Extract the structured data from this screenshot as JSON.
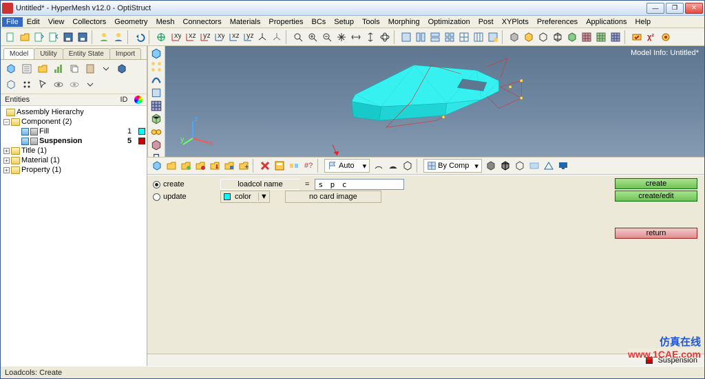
{
  "title": "Untitled* - HyperMesh v12.0 - OptiStruct",
  "menus": [
    "File",
    "Edit",
    "View",
    "Collectors",
    "Geometry",
    "Mesh",
    "Connectors",
    "Materials",
    "Properties",
    "BCs",
    "Setup",
    "Tools",
    "Morphing",
    "Optimization",
    "Post",
    "XYPlots",
    "Preferences",
    "Applications",
    "Help"
  ],
  "tabs": {
    "model": "Model",
    "utility": "Utility",
    "entity": "Entity State",
    "import": "Import"
  },
  "tree_head": {
    "entities": "Entities",
    "id": "ID"
  },
  "tree": {
    "assembly": "Assembly Hierarchy",
    "component": "Component (2)",
    "fill": {
      "name": "Fill",
      "id": "1"
    },
    "susp": {
      "name": "Suspension",
      "id": "5"
    },
    "title": "Title (1)",
    "material": "Material (1)",
    "property": "Property (1)"
  },
  "model_info": "Model Info: Untitled*",
  "auto": "Auto",
  "bycomp": "By Comp",
  "panel": {
    "create": "create",
    "update": "update",
    "loadcol": "loadcol name",
    "eq": "=",
    "value": "s p c",
    "color": "color",
    "nocard": "no card image",
    "btn_create": "create",
    "btn_edit": "create/edit",
    "btn_return": "return"
  },
  "footer": {
    "susp": "Suspension"
  },
  "status": "Loadcols: Create",
  "watermark_cn": "仿真在线",
  "watermark_url": "www.1CAE.com"
}
